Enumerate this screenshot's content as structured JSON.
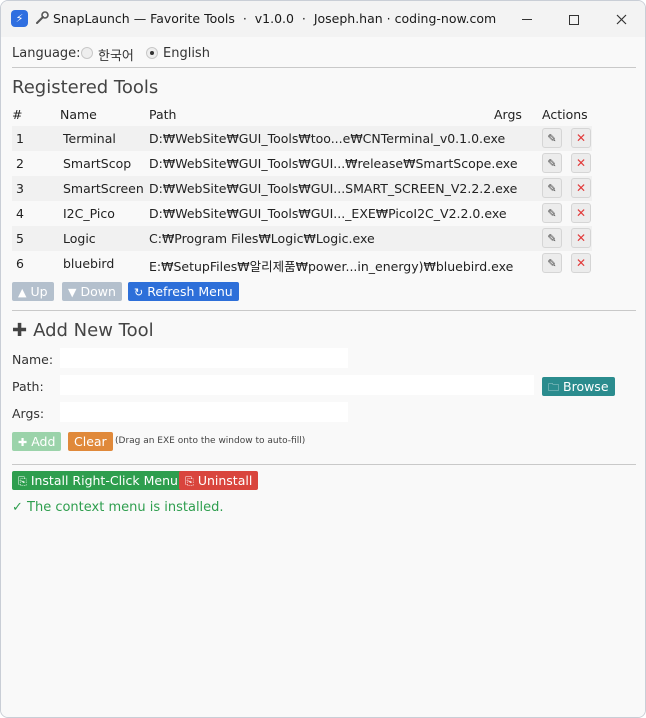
{
  "titlebar": {
    "app_icon": "lightning-icon",
    "tool_icon": "wrench-icon",
    "title": "SnapLaunch — Favorite Tools  ·  v1.0.0  ·  Joseph.han · coding-now.com"
  },
  "language": {
    "label": "Language:",
    "options": [
      {
        "label": "한국어",
        "checked": false
      },
      {
        "label": "English",
        "checked": true
      }
    ]
  },
  "registered": {
    "title": "Registered Tools",
    "headers": {
      "num": "#",
      "name": "Name",
      "path": "Path",
      "args": "Args",
      "actions": "Actions"
    },
    "rows": [
      {
        "num": "1",
        "name": "Terminal",
        "path": "D:₩WebSite₩GUI_Tools₩too...e₩CNTerminal_v0.1.0.exe",
        "args": ""
      },
      {
        "num": "2",
        "name": "SmartScop",
        "path": "D:₩WebSite₩GUI_Tools₩GUI...₩release₩SmartScope.exe",
        "args": ""
      },
      {
        "num": "3",
        "name": "SmartScreen",
        "path": "D:₩WebSite₩GUI_Tools₩GUI...SMART_SCREEN_V2.2.2.exe",
        "args": ""
      },
      {
        "num": "4",
        "name": "I2C_Pico",
        "path": "D:₩WebSite₩GUI_Tools₩GUI..._EXE₩PicoI2C_V2.2.0.exe",
        "args": ""
      },
      {
        "num": "5",
        "name": "Logic",
        "path": "C:₩Program Files₩Logic₩Logic.exe",
        "args": ""
      },
      {
        "num": "6",
        "name": "bluebird",
        "path": "E:₩SetupFiles₩알리제품₩power...in_energy)₩bluebird.exe",
        "args": ""
      }
    ],
    "up_label": "Up",
    "down_label": "Down",
    "refresh_label": "Refresh Menu"
  },
  "add_tool": {
    "title": "Add New Tool",
    "name_label": "Name:",
    "path_label": "Path:",
    "args_label": "Args:",
    "name_value": "",
    "path_value": "",
    "args_value": "",
    "browse_label": "Browse",
    "add_label": "Add",
    "clear_label": "Clear",
    "hint": "(Drag an EXE onto the window to auto-fill)"
  },
  "context_menu": {
    "install_label": "Install Right-Click Menu",
    "uninstall_label": "Uninstall",
    "status": "✓ The context menu is installed."
  },
  "colors": {
    "accent_blue": "#2d6fd9",
    "green": "#2e9e4e",
    "orange": "#e0893a",
    "teal": "#2b8c8e",
    "red": "#d9453d"
  }
}
